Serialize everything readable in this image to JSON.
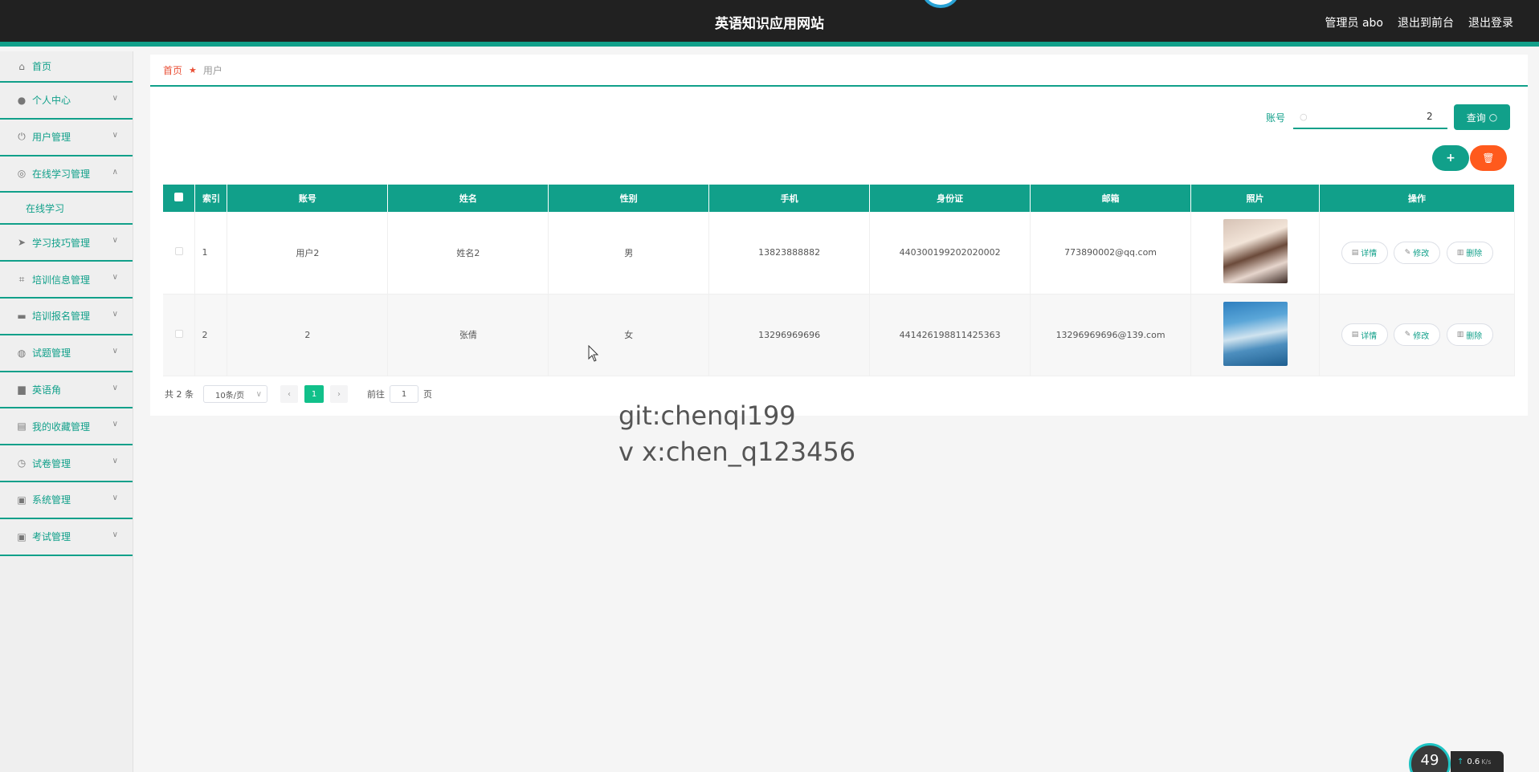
{
  "header": {
    "site_title": "英语知识应用网站",
    "admin_label": "管理员 abo",
    "back_to_front": "退出到前台",
    "logout": "退出登录"
  },
  "sidebar": {
    "items": [
      {
        "label": "首页",
        "icon": "home-icon"
      },
      {
        "label": "个人中心",
        "icon": "user-icon"
      },
      {
        "label": "用户管理",
        "icon": "power-icon"
      },
      {
        "label": "在线学习管理",
        "icon": "compass-icon",
        "expanded": true
      },
      {
        "label": "学习技巧管理",
        "icon": "send-icon"
      },
      {
        "label": "培训信息管理",
        "icon": "crop-icon"
      },
      {
        "label": "培训报名管理",
        "icon": "message-icon"
      },
      {
        "label": "试题管理",
        "icon": "globe-icon"
      },
      {
        "label": "英语角",
        "icon": "briefcase-icon"
      },
      {
        "label": "我的收藏管理",
        "icon": "printer-icon"
      },
      {
        "label": "试卷管理",
        "icon": "clock-icon"
      },
      {
        "label": "系统管理",
        "icon": "clipboard-icon"
      },
      {
        "label": "考试管理",
        "icon": "clipboard-icon"
      }
    ],
    "submenu": {
      "label": "在线学习"
    }
  },
  "breadcrumb": {
    "home": "首页",
    "current": "用户"
  },
  "search": {
    "label": "账号",
    "value": "2",
    "button": "查询"
  },
  "table": {
    "headers": [
      "索引",
      "账号",
      "姓名",
      "性别",
      "手机",
      "身份证",
      "邮箱",
      "照片",
      "操作"
    ],
    "rows": [
      {
        "index": "1",
        "account": "用户2",
        "name": "姓名2",
        "gender": "男",
        "phone": "13823888882",
        "id_card": "440300199202020002",
        "email": "773890002@qq.com"
      },
      {
        "index": "2",
        "account": "2",
        "name": "张倩",
        "gender": "女",
        "phone": "13296969696",
        "id_card": "441426198811425363",
        "email": "13296969696@139.com"
      }
    ],
    "actions": {
      "detail": "详情",
      "edit": "修改",
      "delete": "删除"
    }
  },
  "pagination": {
    "total": "共 2 条",
    "page_size": "10条/页",
    "current_page": "1",
    "goto_label": "前往",
    "goto_value": "1",
    "goto_suffix": "页"
  },
  "watermark": {
    "line1": "git:chenqi199",
    "line2": "v x:chen_q123456"
  },
  "net_widget": {
    "percent": "49",
    "speed": "0.6",
    "unit": "K/s"
  },
  "colors": {
    "primary": "#11a08a",
    "danger": "#ff5a1d",
    "header_bg": "#212121",
    "breadcrumb_home": "#e94f36"
  }
}
